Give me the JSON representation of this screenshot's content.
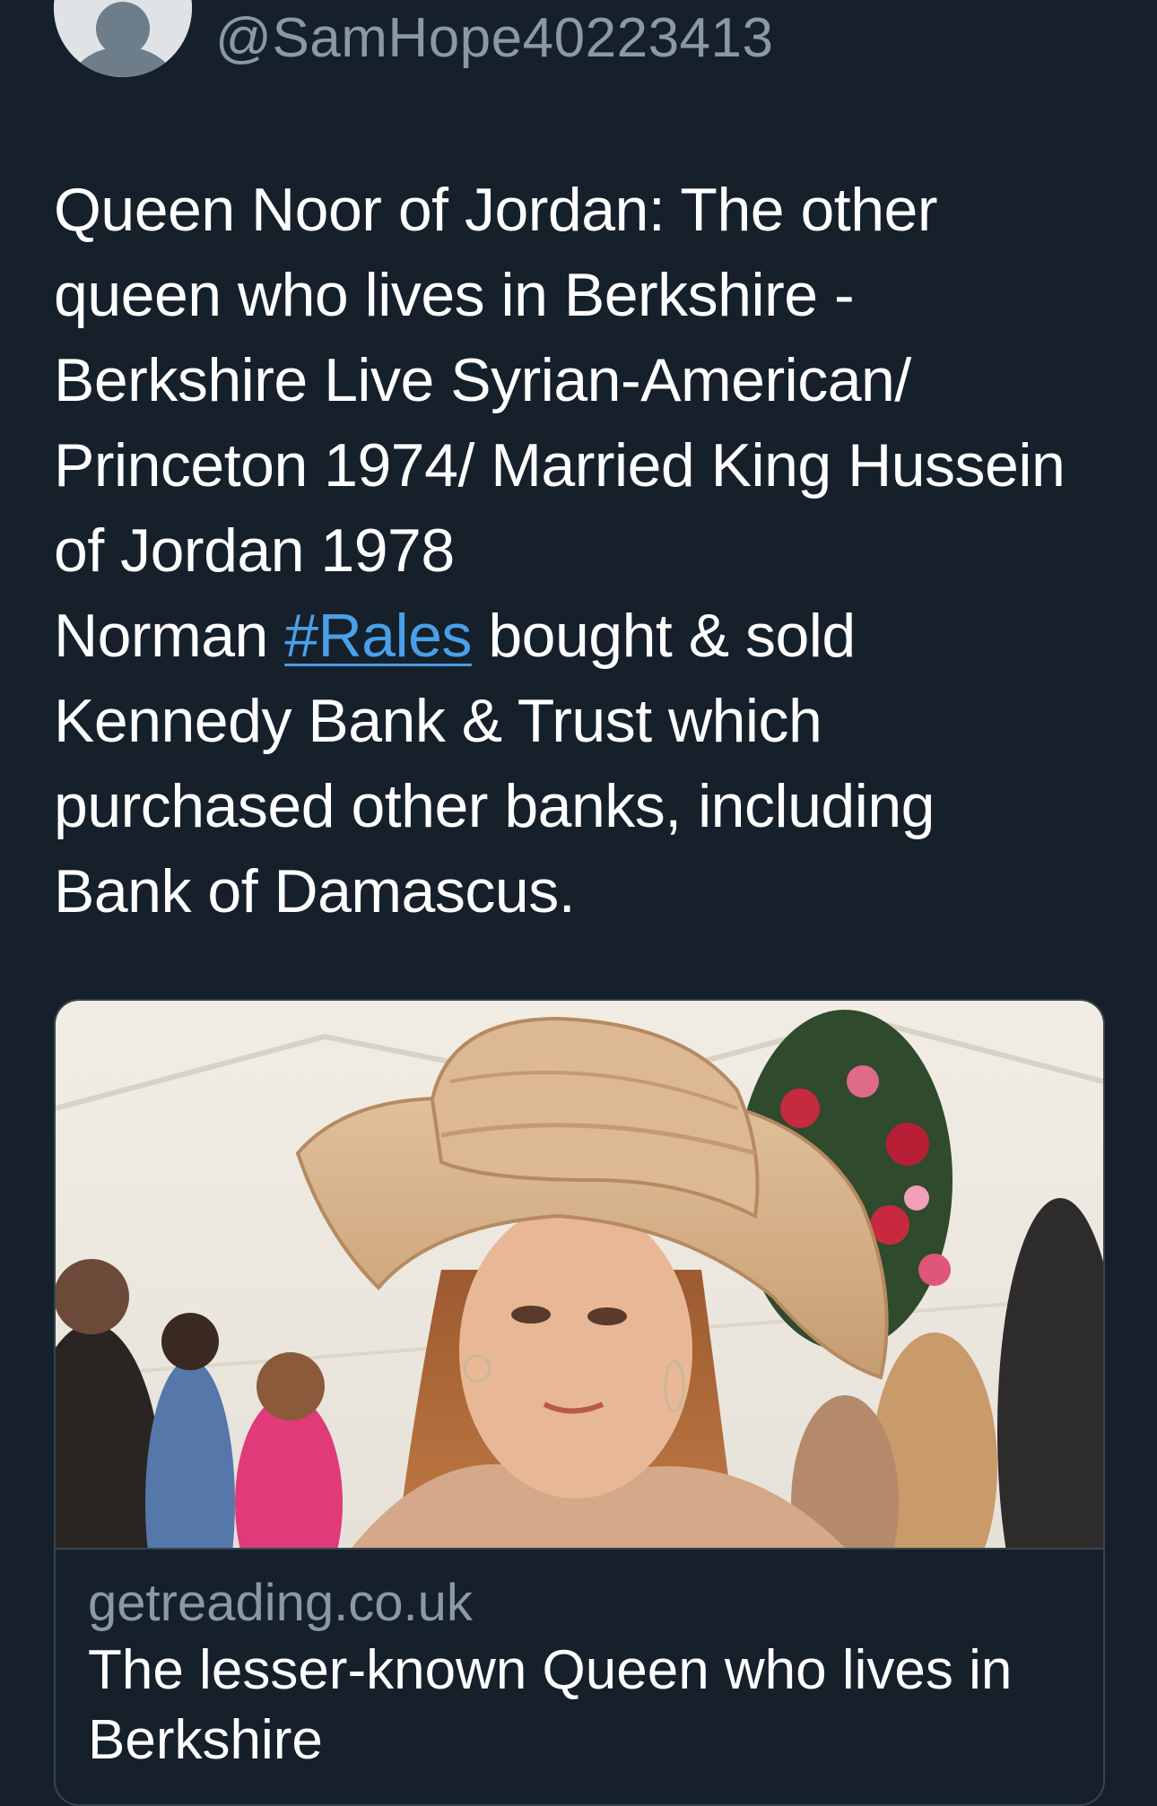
{
  "tweet": {
    "handle": "@SamHope40223413",
    "text_lines": [
      "Queen Noor of Jordan: The other",
      "queen who lives in Berkshire -",
      "Berkshire Live Syrian-American/",
      "Princeton 1974/ Married King Hussein",
      "of Jordan 1978"
    ],
    "line6_before": "Norman ",
    "hashtag": "#Rales",
    "line6_after": " bought & sold",
    "text_lines_end": [
      "Kennedy Bank & Trust which",
      "purchased other banks, including",
      "Bank of Damascus."
    ]
  },
  "card": {
    "image_icon": "photo-woman-in-hat",
    "domain": "getreading.co.uk",
    "title_line1": "The lesser-known Queen who lives in",
    "title_line2": "Berkshire"
  },
  "colors": {
    "background": "#15202b",
    "text": "#ffffff",
    "muted": "#8b98a5",
    "link": "#4a9fe8",
    "border": "#38444d"
  }
}
